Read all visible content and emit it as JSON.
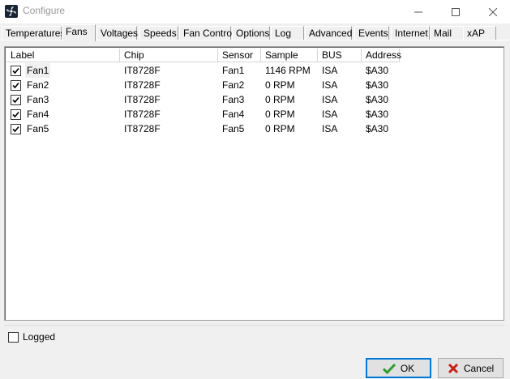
{
  "window": {
    "title": "Configure"
  },
  "tabs": [
    {
      "label": "Temperatures"
    },
    {
      "label": "Fans"
    },
    {
      "label": "Voltages"
    },
    {
      "label": "Speeds"
    },
    {
      "label": "Fan Control"
    },
    {
      "label": "Options"
    },
    {
      "label": "Log"
    },
    {
      "label": "Advanced"
    },
    {
      "label": "Events"
    },
    {
      "label": "Internet"
    },
    {
      "label": "Mail"
    },
    {
      "label": "xAP"
    }
  ],
  "active_tab": "Fans",
  "columns": [
    "Label",
    "Chip",
    "Sensor",
    "Sample",
    "BUS",
    "Address"
  ],
  "rows": [
    {
      "label": "Fan1",
      "chip": "IT8728F",
      "sensor": "Fan1",
      "sample": "1146 RPM",
      "bus": "ISA",
      "address": "$A30",
      "checked": true
    },
    {
      "label": "Fan2",
      "chip": "IT8728F",
      "sensor": "Fan2",
      "sample": "0 RPM",
      "bus": "ISA",
      "address": "$A30",
      "checked": true
    },
    {
      "label": "Fan3",
      "chip": "IT8728F",
      "sensor": "Fan3",
      "sample": "0 RPM",
      "bus": "ISA",
      "address": "$A30",
      "checked": true
    },
    {
      "label": "Fan4",
      "chip": "IT8728F",
      "sensor": "Fan4",
      "sample": "0 RPM",
      "bus": "ISA",
      "address": "$A30",
      "checked": true
    },
    {
      "label": "Fan5",
      "chip": "IT8728F",
      "sensor": "Fan5",
      "sample": "0 RPM",
      "bus": "ISA",
      "address": "$A30",
      "checked": true
    }
  ],
  "logged": {
    "label": "Logged",
    "checked": false
  },
  "buttons": {
    "ok": "OK",
    "cancel": "Cancel"
  },
  "icons": {
    "ok": "checkmark-icon",
    "cancel": "x-icon"
  },
  "colors": {
    "ok_icon": "#2e9b2e",
    "cancel_icon": "#c8201a"
  }
}
